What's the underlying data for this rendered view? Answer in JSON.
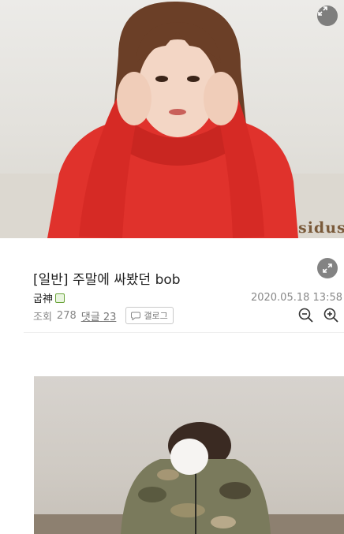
{
  "post": {
    "title": "[일반] 주말에 싸봤던 bob",
    "author": "굽神",
    "date": "2020.05.18 13:58",
    "views_label": "조회",
    "views": "278",
    "comments_label": "댓글",
    "comments": "23",
    "gallog_label": "갤로그"
  },
  "hero_image": {
    "watermark": "sidus"
  },
  "icons": {
    "expand": "expand-icon",
    "zoom_out": "zoom-out-icon",
    "zoom_in": "zoom-in-icon",
    "gallog": "chat-bubble-icon",
    "badge": "member-badge-icon"
  },
  "colors": {
    "jacket": "#e0322c",
    "text": "#222222",
    "muted": "#888888"
  }
}
